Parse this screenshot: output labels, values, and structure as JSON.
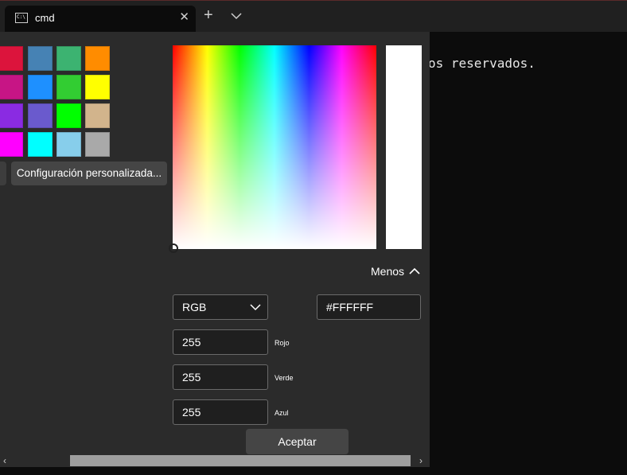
{
  "window": {
    "tab_title": "cmd",
    "tab_icon": "terminal-icon",
    "close_glyph": "✕",
    "new_tab_glyph": "+"
  },
  "terminal": {
    "visible_text": "os reservados."
  },
  "picker": {
    "swatches": [
      "#dc143c",
      "#4682b4",
      "#3cb371",
      "#ff8c00",
      "#c71585",
      "#1e90ff",
      "#32cd32",
      "#ffff00",
      "#8a2be2",
      "#6a5acd",
      "#00ff00",
      "#d2b48c",
      "#ff00ff",
      "#00ffff",
      "#87ceeb",
      "#a9a9a9"
    ],
    "custom_label": "Configuración personalizada...",
    "preview_color": "#ffffff",
    "less_label": "Menos",
    "mode_value": "RGB",
    "hex_value": "#FFFFFF",
    "channels": [
      {
        "label": "Rojo",
        "value": "255"
      },
      {
        "label": "Verde",
        "value": "255"
      },
      {
        "label": "Azul",
        "value": "255"
      }
    ],
    "accept_label": "Aceptar"
  },
  "scrollbar": {
    "left_glyph": "‹",
    "right_glyph": "›"
  }
}
